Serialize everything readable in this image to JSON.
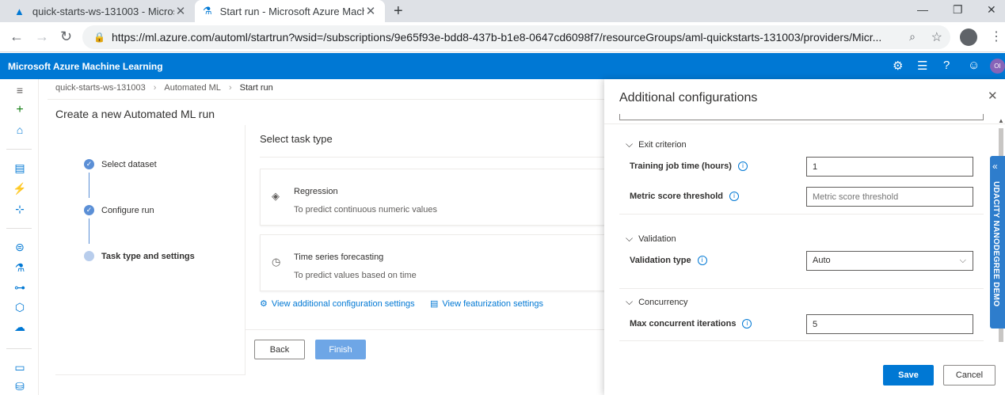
{
  "browser": {
    "tabs": [
      {
        "title": "quick-starts-ws-131003 - Microsoft",
        "active": false
      },
      {
        "title": "Start run - Microsoft Azure Machine Learning",
        "active": true
      }
    ],
    "url": "https://ml.azure.com/automl/startrun?wsid=/subscriptions/9e65f93e-bdd8-437b-b1e8-0647cd6098f7/resourceGroups/aml-quickstarts-131003/providers/Micr..."
  },
  "azure": {
    "app_title": "Microsoft Azure Machine Learning",
    "avatar_initials": "OI"
  },
  "breadcrumb": [
    "quick-starts-ws-131003",
    "Automated ML",
    "Start run"
  ],
  "page_title": "Create a new Automated ML run",
  "steps": [
    {
      "label": "Select dataset",
      "state": "done"
    },
    {
      "label": "Configure run",
      "state": "done"
    },
    {
      "label": "Task type and settings",
      "state": "current"
    }
  ],
  "task": {
    "heading": "Select task type",
    "cards": [
      {
        "name": "Regression",
        "desc": "To predict continuous numeric values",
        "icon": "regression-icon"
      },
      {
        "name": "Time series forecasting",
        "desc": "To predict values based on time",
        "icon": "clock-icon"
      }
    ],
    "links": {
      "additional": "View additional configuration settings",
      "featurization": "View featurization settings"
    }
  },
  "buttons": {
    "back": "Back",
    "finish": "Finish"
  },
  "panel": {
    "title": "Additional configurations",
    "sections": {
      "exit": {
        "title": "Exit criterion"
      },
      "validation": {
        "title": "Validation"
      },
      "concurrency": {
        "title": "Concurrency"
      }
    },
    "fields": {
      "training_time": {
        "label": "Training job time (hours)",
        "value": "1"
      },
      "metric_threshold": {
        "label": "Metric score threshold",
        "placeholder": "Metric score threshold"
      },
      "validation_type": {
        "label": "Validation type",
        "value": "Auto"
      },
      "max_concurrent": {
        "label": "Max concurrent iterations",
        "value": "5"
      }
    },
    "save": "Save",
    "cancel": "Cancel"
  },
  "ribbon": {
    "text": "UDACITY NANODEGREE DEMO"
  },
  "colors": {
    "azure_blue": "#0078d4",
    "finish_disabled": "#6ea6e6",
    "ribbon": "#2e7dcc"
  }
}
